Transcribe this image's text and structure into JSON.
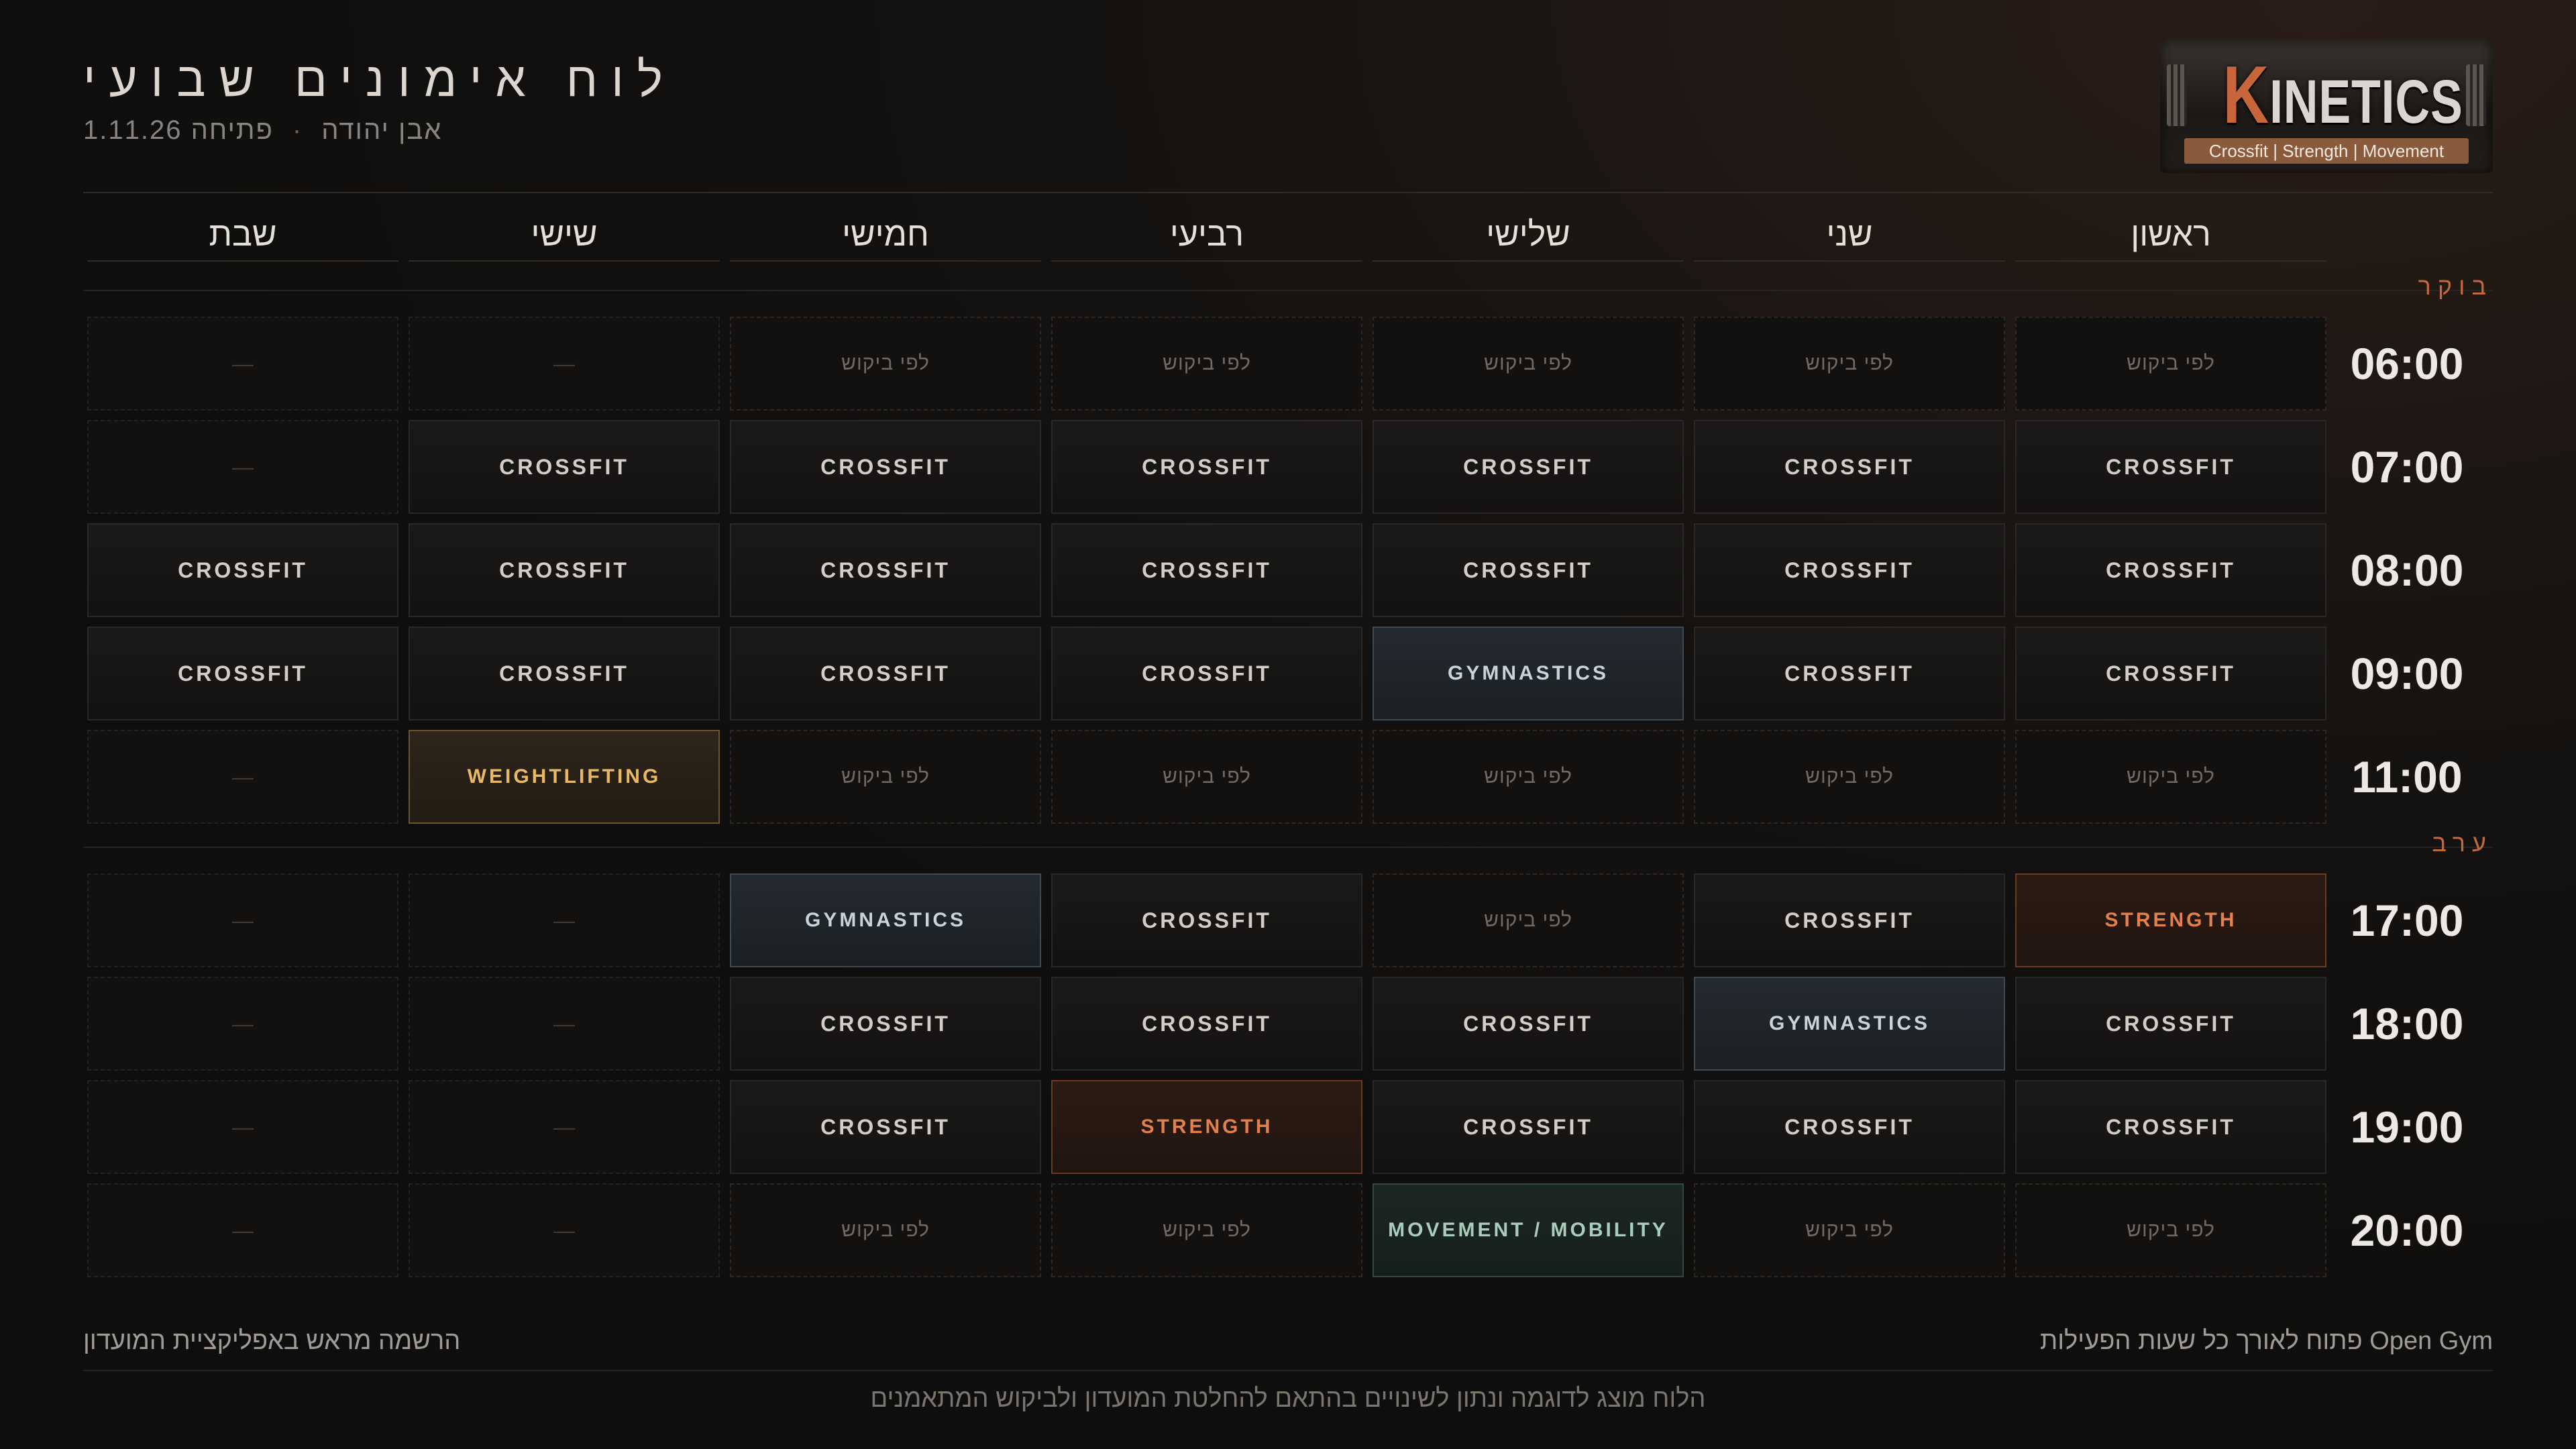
{
  "header": {
    "title": "לוח אימונים שבועי",
    "location": "אבן יהודה",
    "separator": "·",
    "opening": "פתיחה 1.11.26"
  },
  "logo": {
    "brand_first": "K",
    "brand_rest": "INETICS",
    "tagline": "Crossfit | Strength | Movement"
  },
  "days": [
    "ראשון",
    "שני",
    "שלישי",
    "רביעי",
    "חמישי",
    "שישי",
    "שבת"
  ],
  "sections": {
    "morning": "בוקר",
    "evening": "ערב"
  },
  "schedule": {
    "morning": [
      {
        "time": "06:00",
        "slots": [
          "לפי ביקוש",
          "לפי ביקוש",
          "לפי ביקוש",
          "לפי ביקוש",
          "לפי ביקוש",
          "—",
          "—"
        ]
      },
      {
        "time": "07:00",
        "slots": [
          "CROSSFIT",
          "CROSSFIT",
          "CROSSFIT",
          "CROSSFIT",
          "CROSSFIT",
          "CROSSFIT",
          "—"
        ]
      },
      {
        "time": "08:00",
        "slots": [
          "CROSSFIT",
          "CROSSFIT",
          "CROSSFIT",
          "CROSSFIT",
          "CROSSFIT",
          "CROSSFIT",
          "CROSSFIT"
        ]
      },
      {
        "time": "09:00",
        "slots": [
          "CROSSFIT",
          "CROSSFIT",
          "GYMNASTICS",
          "CROSSFIT",
          "CROSSFIT",
          "CROSSFIT",
          "CROSSFIT"
        ]
      },
      {
        "time": "11:00",
        "slots": [
          "לפי ביקוש",
          "לפי ביקוש",
          "לפי ביקוש",
          "לפי ביקוש",
          "לפי ביקוש",
          "WEIGHTLIFTING",
          "—"
        ]
      }
    ],
    "evening": [
      {
        "time": "17:00",
        "slots": [
          "STRENGTH",
          "CROSSFIT",
          "לפי ביקוש",
          "CROSSFIT",
          "GYMNASTICS",
          "—",
          "—"
        ]
      },
      {
        "time": "18:00",
        "slots": [
          "CROSSFIT",
          "GYMNASTICS",
          "CROSSFIT",
          "CROSSFIT",
          "CROSSFIT",
          "—",
          "—"
        ]
      },
      {
        "time": "19:00",
        "slots": [
          "CROSSFIT",
          "CROSSFIT",
          "CROSSFIT",
          "STRENGTH",
          "CROSSFIT",
          "—",
          "—"
        ]
      },
      {
        "time": "20:00",
        "slots": [
          "לפי ביקוש",
          "לפי ביקוש",
          "MOVEMENT / MOBILITY",
          "לפי ביקוש",
          "לפי ביקוש",
          "—",
          "—"
        ]
      }
    ]
  },
  "footer": {
    "open_gym": "Open Gym פתוח לאורך כל שעות הפעילות",
    "registration": "הרשמה מראש באפליקציית המועדון",
    "disclaimer": "הלוח מוצג לדוגמה ונתון לשינויים בהתאם להחלטת המועדון ולביקוש המתאמנים"
  },
  "colors": {
    "accent": "#c2683f",
    "strength": "#e4804c",
    "weightlifting": "#e8b865",
    "gymnastics": "#c9d3da",
    "mobility": "#a9ccbd"
  }
}
